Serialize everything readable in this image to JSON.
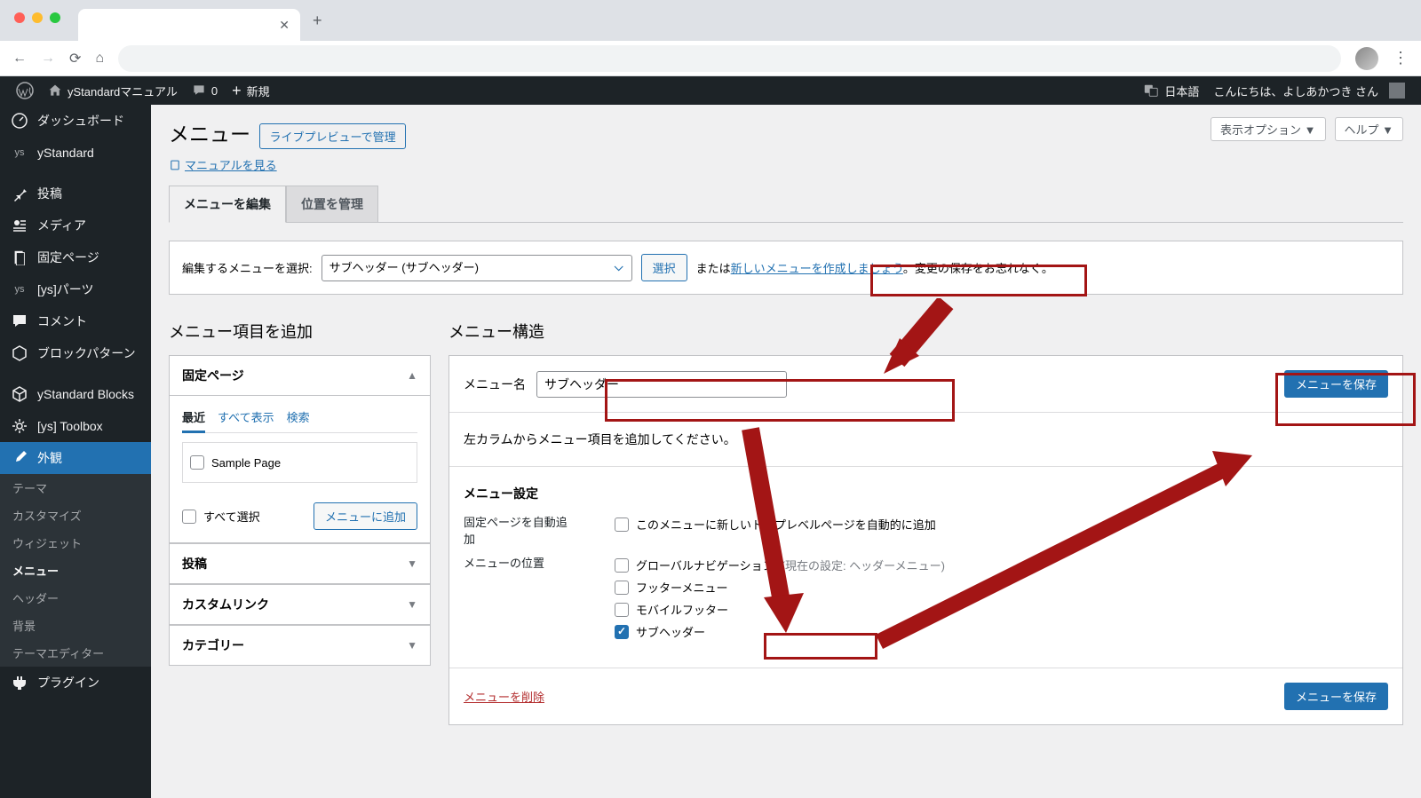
{
  "browser": {
    "new_tab_icon": "+"
  },
  "adminbar": {
    "site_name": "yStandardマニュアル",
    "comments": "0",
    "new": "新規",
    "lang": "日本語",
    "greeting": "こんにちは、よしあかつき さん"
  },
  "sidebar": {
    "dashboard": "ダッシュボード",
    "ystandard": "yStandard",
    "posts": "投稿",
    "media": "メディア",
    "pages": "固定ページ",
    "ys_parts": "[ys]パーツ",
    "comments": "コメント",
    "block_patterns": "ブロックパターン",
    "ys_blocks": "yStandard Blocks",
    "ys_toolbox": "[ys] Toolbox",
    "appearance": "外観",
    "appearance_sub": {
      "themes": "テーマ",
      "customize": "カスタマイズ",
      "widgets": "ウィジェット",
      "menus": "メニュー",
      "header": "ヘッダー",
      "background": "背景",
      "theme_editor": "テーマエディター"
    },
    "plugins": "プラグイン"
  },
  "topright": {
    "screen_options": "表示オプション ▼",
    "help": "ヘルプ ▼"
  },
  "header": {
    "title": "メニュー",
    "live_preview": "ライブプレビューで管理",
    "manual_link": "マニュアルを見る"
  },
  "tabs": {
    "edit": "メニューを編集",
    "locations": "位置を管理"
  },
  "selectbar": {
    "label": "編集するメニューを選択:",
    "selected": "サブヘッダー (サブヘッダー)",
    "select_btn": "選択",
    "or": "または",
    "create_new": "新しいメニューを作成しましょう",
    "period": "。",
    "save_note": "変更の保存をお忘れなく。"
  },
  "left_col": {
    "title": "メニュー項目を追加",
    "acc_pages": "固定ページ",
    "inner_tabs": {
      "recent": "最近",
      "all": "すべて表示",
      "search": "検索"
    },
    "sample_page": "Sample Page",
    "select_all": "すべて選択",
    "add_to_menu": "メニューに追加",
    "acc_posts": "投稿",
    "acc_custom": "カスタムリンク",
    "acc_category": "カテゴリー"
  },
  "right_col": {
    "title": "メニュー構造",
    "menu_name_label": "メニュー名",
    "menu_name_value": "サブヘッダー",
    "save_btn": "メニューを保存",
    "instruction": "左カラムからメニュー項目を追加してください。",
    "settings_title": "メニュー設定",
    "auto_add_label": "固定ページを自動追加",
    "auto_add_opt": "このメニューに新しいトップレベルページを自動的に追加",
    "locations_label": "メニューの位置",
    "loc_global": "グローバルナビゲーション",
    "loc_global_note": "(現在の設定: ヘッダーメニュー)",
    "loc_footer": "フッターメニュー",
    "loc_mobile": "モバイルフッター",
    "loc_subheader": "サブヘッダー",
    "delete_menu": "メニューを削除",
    "save_btn2": "メニューを保存"
  }
}
